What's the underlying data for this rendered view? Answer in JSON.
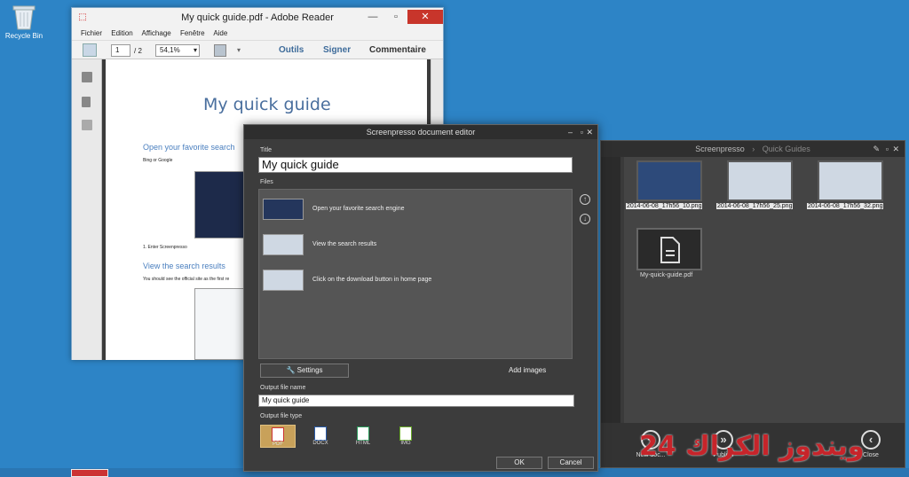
{
  "desktop": {
    "recycle_label": "Recycle Bin"
  },
  "adobe": {
    "title": "My quick guide.pdf - Adobe Reader",
    "menu": [
      "Fichier",
      "Edition",
      "Affichage",
      "Fenêtre",
      "Aide"
    ],
    "page_current": "1",
    "page_total": "/ 2",
    "zoom": "54,1%",
    "tools": {
      "outils": "Outils",
      "signer": "Signer",
      "commentaire": "Commentaire"
    },
    "doc": {
      "title": "My quick guide",
      "h_search": "Open your favorite search",
      "p_bing": "Bing or Google",
      "step1": "1. Enter Screenpresso",
      "h_results": "View the search results",
      "p_results": "You should see the official site as the first re"
    }
  },
  "editor": {
    "title": "Screenpresso document editor",
    "title_label": "Title",
    "title_value": "My quick guide",
    "files_label": "Files",
    "files": [
      "Open your favorite search engine",
      "View the search results",
      "Click on the download button in home page"
    ],
    "settings": "Settings",
    "add_images": "Add images",
    "output_name_label": "Output file name",
    "output_name_value": "My quick guide",
    "output_type_label": "Output file type",
    "types": [
      "PDF",
      "DOCX",
      "HTML",
      "IMG"
    ],
    "ok": "OK",
    "cancel": "Cancel"
  },
  "screenpresso": {
    "title": "Screenpresso",
    "section": "Quick Guides",
    "thumbs": [
      "2014-06-08_17h56_10.png",
      "2014-06-08_17h56_25.png",
      "2014-06-08_17h56_32.png"
    ],
    "pdf_name": "My-quick-guide.pdf",
    "buttons": {
      "new": "New doc...",
      "publish": "Publish",
      "close": "Close"
    }
  },
  "watermark": "24 ويندوز الكراك"
}
